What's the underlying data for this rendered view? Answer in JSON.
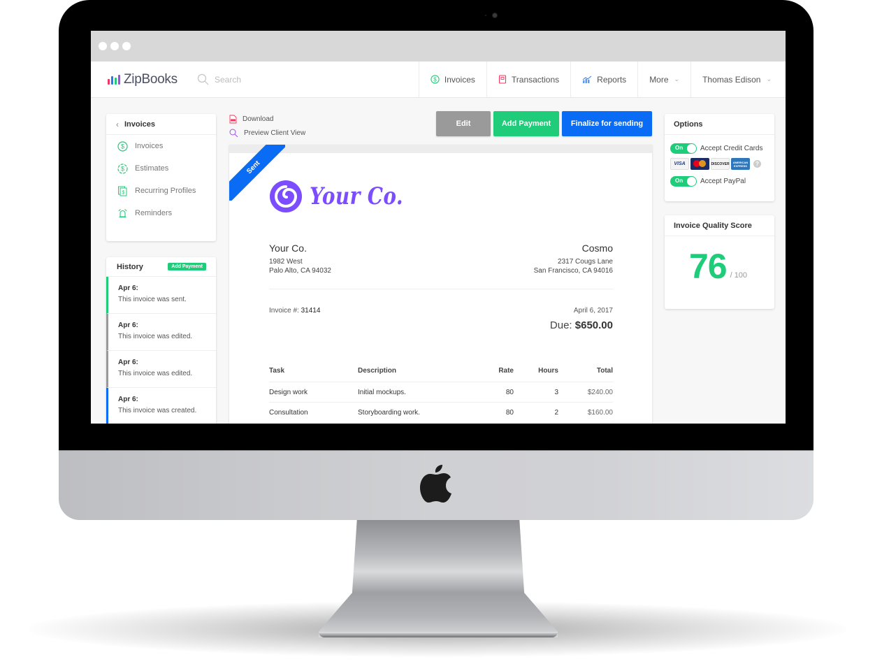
{
  "browser": {
    "window_controls": [
      "close",
      "minimize",
      "maximize"
    ]
  },
  "topnav": {
    "brand": "ZipBooks",
    "brand_bar_colors": [
      "#f5365c",
      "#1e7cf5",
      "#1ecc7a",
      "#9b51e0"
    ],
    "search_placeholder": "Search",
    "items": [
      {
        "label": "Invoices",
        "icon": "dollar-circle-icon"
      },
      {
        "label": "Transactions",
        "icon": "notebook-icon"
      },
      {
        "label": "Reports",
        "icon": "chart-icon"
      },
      {
        "label": "More",
        "icon": "chevron-down-icon"
      },
      {
        "label": "Thomas Edison",
        "icon": "chevron-down-icon"
      }
    ]
  },
  "sidebar": {
    "back_label": "Invoices",
    "items": [
      {
        "label": "Invoices",
        "icon": "dollar-circle-icon"
      },
      {
        "label": "Estimates",
        "icon": "dollar-dashed-circle-icon"
      },
      {
        "label": "Recurring Profiles",
        "icon": "recurring-docs-icon"
      },
      {
        "label": "Reminders",
        "icon": "alarm-bell-icon"
      }
    ]
  },
  "history": {
    "title": "History",
    "add_payment_label": "Add Payment",
    "items": [
      {
        "date": "Apr 6:",
        "text": "This invoice was sent.",
        "color": "#1ecc7a"
      },
      {
        "date": "Apr 6:",
        "text": "This invoice was edited.",
        "color": "#999999"
      },
      {
        "date": "Apr 6:",
        "text": "This invoice was edited.",
        "color": "#999999"
      },
      {
        "date": "Apr 6:",
        "text": "This invoice was created.",
        "color": "#0a6cf5"
      }
    ]
  },
  "actions": {
    "download_label": "Download",
    "preview_label": "Preview Client View",
    "edit_label": "Edit",
    "add_payment_label": "Add Payment",
    "finalize_label": "Finalize for sending"
  },
  "invoice": {
    "status_ribbon": "Sent",
    "logo_text": "Your Co.",
    "from": {
      "name": "Your Co.",
      "line1": "1982 West",
      "line2": "Palo Alto, CA 94032"
    },
    "to": {
      "name": "Cosmo",
      "line1": "2317 Cougs Lane",
      "line2": "San Francisco, CA 94016"
    },
    "number_label": "Invoice #:",
    "number": "31414",
    "date": "April 6, 2017",
    "due_label": "Due:",
    "due_amount": "$650.00",
    "columns": [
      "Task",
      "Description",
      "Rate",
      "Hours",
      "Total"
    ],
    "rows": [
      {
        "task": "Design work",
        "description": "Initial mockups.",
        "rate": "80",
        "hours": "3",
        "total": "$240.00"
      },
      {
        "task": "Consultation",
        "description": "Storyboarding work.",
        "rate": "80",
        "hours": "2",
        "total": "$160.00"
      }
    ]
  },
  "options": {
    "title": "Options",
    "credit_cards": {
      "toggle": "On",
      "label": "Accept Credit Cards",
      "enabled": true
    },
    "card_brands": [
      "VISA",
      "MasterCard",
      "DISCOVER",
      "AMERICAN EXPRESS"
    ],
    "paypal": {
      "toggle": "On",
      "label": "Accept PayPal",
      "enabled": true
    }
  },
  "quality": {
    "title": "Invoice Quality Score",
    "score": "76",
    "out_of": "/ 100"
  },
  "colors": {
    "green": "#1ecc7a",
    "blue": "#0a6cf5",
    "gray_button": "#9a9a9a",
    "brand_purple": "#7b4dff"
  }
}
